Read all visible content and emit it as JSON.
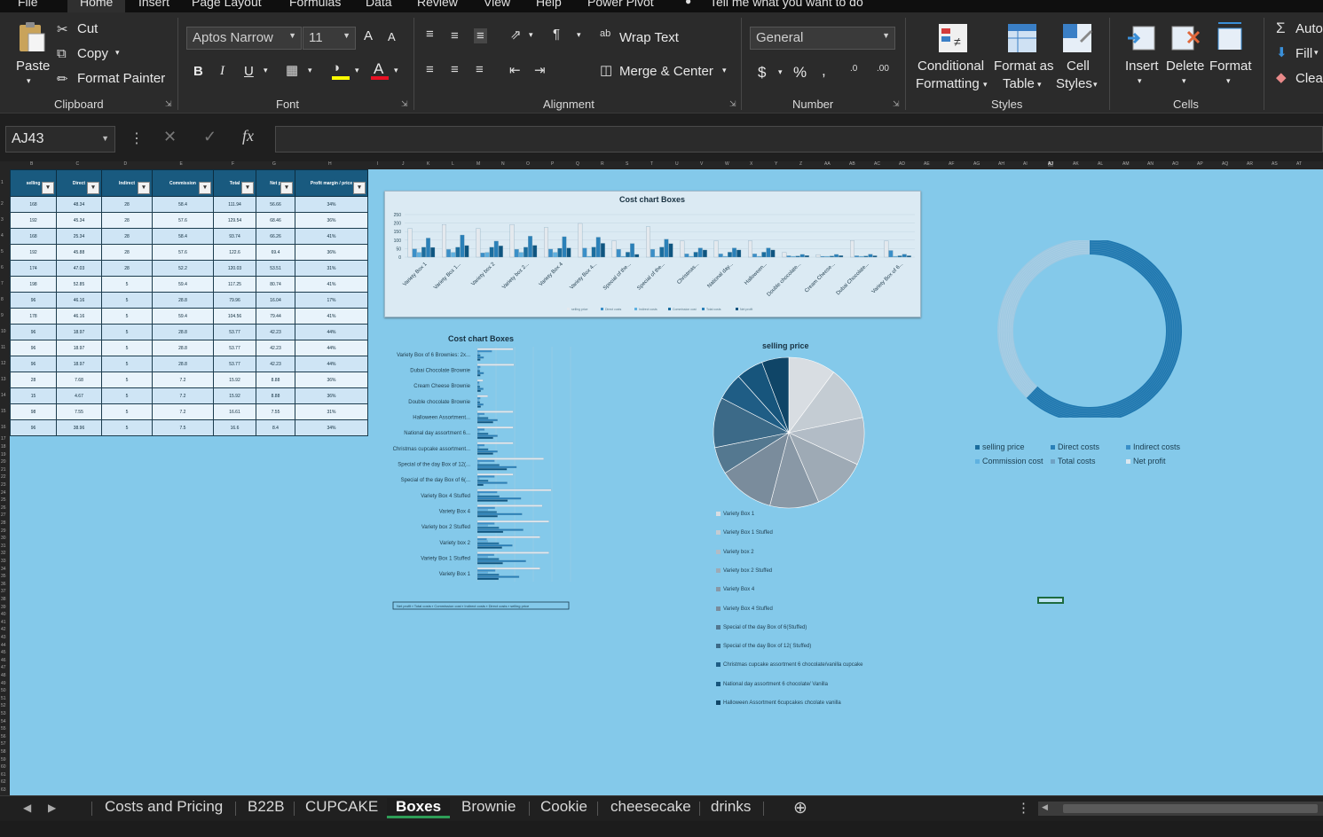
{
  "menu": {
    "tabs": [
      "File",
      "Home",
      "Insert",
      "Page Layout",
      "Formulas",
      "Data",
      "Review",
      "View",
      "Help",
      "Power Pivot"
    ],
    "active": "Home",
    "tell_me": "Tell me what you want to do"
  },
  "ribbon": {
    "clipboard": {
      "paste": "Paste",
      "cut": "Cut",
      "copy": "Copy",
      "format_painter": "Format Painter",
      "label": "Clipboard"
    },
    "font": {
      "family": "Aptos Narrow",
      "size": "11",
      "bold": "B",
      "italic": "I",
      "underline": "U",
      "label": "Font",
      "grow": "A",
      "shrink": "A"
    },
    "alignment": {
      "wrap": "Wrap Text",
      "merge": "Merge & Center",
      "label": "Alignment"
    },
    "number": {
      "format": "General",
      "currency": "$",
      "percent": "%",
      "comma": ",",
      "label": "Number"
    },
    "styles": {
      "cond1": "Conditional",
      "cond2": "Formatting",
      "fmt1": "Format as",
      "fmt2": "Table",
      "cell1": "Cell",
      "cell2": "Styles",
      "label": "Styles"
    },
    "cells": {
      "insert": "Insert",
      "delete": "Delete",
      "format": "Format",
      "label": "Cells"
    },
    "editing": {
      "autosum": "Auto",
      "fill": "Fill",
      "clear": "Clea"
    }
  },
  "formula_bar": {
    "name_box": "AJ43",
    "fx": "fx",
    "content": ""
  },
  "colors": {
    "sheet_bg": "#84c9ea",
    "header_blue": "#195a7f",
    "accent_green": "#2e9e57"
  },
  "table": {
    "headers": [
      "selling",
      "Direct",
      "Indirect",
      "Commission",
      "Total",
      "Net p",
      "Profit margin / price"
    ],
    "rows": [
      [
        "168",
        "48.34",
        "28",
        "58.4",
        "111.94",
        "56.66",
        "34%"
      ],
      [
        "192",
        "45.34",
        "28",
        "57.6",
        "129.54",
        "68.46",
        "36%"
      ],
      [
        "168",
        "25.34",
        "28",
        "58.4",
        "93.74",
        "66.26",
        "41%"
      ],
      [
        "192",
        "45.88",
        "28",
        "57.6",
        "122.6",
        "69.4",
        "36%"
      ],
      [
        "174",
        "47.03",
        "28",
        "52.2",
        "120.03",
        "53.51",
        "31%"
      ],
      [
        "198",
        "52.85",
        "5",
        "59.4",
        "117.25",
        "80.74",
        "41%"
      ],
      [
        "96",
        "46.16",
        "5",
        "28.8",
        "79.96",
        "16.04",
        "17%"
      ],
      [
        "178",
        "46.16",
        "5",
        "59.4",
        "104.56",
        "79.44",
        "41%"
      ],
      [
        "96",
        "18.97",
        "5",
        "28.8",
        "53.77",
        "42.23",
        "44%"
      ],
      [
        "96",
        "18.97",
        "5",
        "28.8",
        "53.77",
        "42.23",
        "44%"
      ],
      [
        "96",
        "18.97",
        "5",
        "28.8",
        "53.77",
        "42.23",
        "44%"
      ],
      [
        "28",
        "7.68",
        "5",
        "7.2",
        "15.92",
        "8.88",
        "36%"
      ],
      [
        "15",
        "4.67",
        "5",
        "7.2",
        "15.92",
        "8.88",
        "36%"
      ],
      [
        "98",
        "7.55",
        "5",
        "7.2",
        "16.61",
        "7.55",
        "31%"
      ],
      [
        "96",
        "38.96",
        "5",
        "7.5",
        "16.6",
        "8.4",
        "34%"
      ]
    ]
  },
  "col_letters": [
    "B",
    "C",
    "D",
    "E",
    "F",
    "G",
    "H",
    "I",
    "J",
    "K",
    "L",
    "M",
    "N",
    "O",
    "P",
    "Q",
    "R",
    "S",
    "T",
    "U",
    "V",
    "W",
    "X",
    "Y",
    "Z",
    "AA",
    "AB",
    "AC",
    "AD",
    "AE",
    "AF",
    "AG",
    "AH",
    "AI",
    "AJ",
    "AK",
    "AL",
    "AM",
    "AN",
    "AO",
    "AP",
    "AQ",
    "AR",
    "AS",
    "AT"
  ],
  "chart_data": [
    {
      "type": "bar",
      "title": "Cost chart Boxes",
      "categories": [
        "Variety Box 1",
        "Variety Box 1...",
        "Variety box 2",
        "Variety box 2...",
        "Variety Box 4",
        "Variety Box 4...",
        "Special of the...",
        "Special of the...",
        "Christmas...",
        "National day...",
        "Halloween...",
        "Double chocolate...",
        "Cream Cheese...",
        "Dubai Chocolate...",
        "Variety Box of 6..."
      ],
      "series": [
        {
          "name": "selling price",
          "color": "#e4e9ee",
          "values": [
            168,
            192,
            168,
            192,
            174,
            198,
            96,
            178,
            96,
            96,
            96,
            28,
            15,
            98,
            96
          ]
        },
        {
          "name": "Direct costs",
          "color": "#3a8fc8",
          "values": [
            48,
            45,
            25,
            46,
            47,
            53,
            46,
            46,
            19,
            19,
            19,
            8,
            5,
            8,
            39
          ]
        },
        {
          "name": "Indirect costs",
          "color": "#5fb1e0",
          "values": [
            28,
            28,
            28,
            28,
            28,
            5,
            5,
            5,
            5,
            5,
            5,
            5,
            5,
            5,
            5
          ]
        },
        {
          "name": "Commission cost",
          "color": "#1b6d9e",
          "values": [
            58,
            58,
            58,
            58,
            52,
            59,
            29,
            59,
            29,
            29,
            29,
            7,
            7,
            7,
            8
          ]
        },
        {
          "name": "Total costs",
          "color": "#2a80b8",
          "values": [
            112,
            130,
            94,
            123,
            120,
            117,
            80,
            105,
            54,
            54,
            54,
            16,
            16,
            17,
            17
          ]
        },
        {
          "name": "Net profit",
          "color": "#0e5580",
          "values": [
            57,
            68,
            66,
            69,
            54,
            81,
            16,
            79,
            42,
            42,
            42,
            9,
            9,
            8,
            8
          ]
        }
      ],
      "ylim": [
        0,
        250
      ],
      "yticks": [
        "250",
        "200",
        "150",
        "100",
        "50",
        "0"
      ]
    },
    {
      "type": "bar",
      "title": "Cost chart Boxes",
      "orientation": "horizontal",
      "categories": [
        "Variety Box of 6 Brownies: 2x...",
        "Dubai Chocolate Brownie",
        "Cream Cheese Brownie",
        "Double chocolate Brownie",
        "Halloween Assortment...",
        "National day assortment 6...",
        "Christmas cupcake assortment...",
        "Special of the day Box of 12(...",
        "Special of the day Box of 6(...",
        "Variety Box 4 Stuffed",
        "Variety Box 4",
        "Variety box 2 Stuffed",
        "Variety box 2",
        "Variety Box 1 Stuffed",
        "Variety Box 1"
      ],
      "legend": [
        "Net profit",
        "Total costs",
        "Commission cost",
        "Indirect costs",
        "Direct costs",
        "selling price"
      ]
    },
    {
      "type": "pie",
      "title": "selling price",
      "values": [
        168,
        192,
        168,
        192,
        174,
        198,
        96,
        178,
        96,
        96,
        96
      ],
      "colors": [
        "#d8dde2",
        "#c4ccd3",
        "#b2bcc6",
        "#9eaab5",
        "#8998a6",
        "#7a8c9c",
        "#547890",
        "#3c6a88",
        "#1f5d85",
        "#17557c",
        "#0f4567"
      ],
      "legend": [
        "Variety Box 1",
        "Variety Box 1 Stuffed",
        "Variety box 2",
        "Variety box 2 Stuffed",
        "Variety Box 4",
        "Variety Box 4 Stuffed",
        "Special of the day Box of 6(Stuffed)",
        "Special of the day Box of 12( Stuffed)",
        "Christmas cupcake assortment 6 chocolate/vanilla cupcake",
        "National day assortment 6 chocolate/ Vanilla",
        "Halloween Assortment 6cupcakes chcolate vanilla"
      ]
    },
    {
      "type": "pie",
      "subtype": "doughnut",
      "values": [
        62,
        38
      ],
      "colors": [
        "#1f78b0",
        "#9fc9e2"
      ],
      "legend": [
        "selling price",
        "Direct costs",
        "Indirect costs",
        "Commission cost",
        "Total costs",
        "Net profit"
      ],
      "legend_colors": [
        "#1b6d9e",
        "#2a80b8",
        "#3a8fc8",
        "#5fb1e0",
        "#6fa2c4",
        "#dbe7ef"
      ]
    }
  ],
  "sheet_tabs": [
    "Costs and Pricing",
    "B22B",
    "CUPCAKE",
    "Boxes",
    "Brownie",
    "Cookie",
    "cheesecake",
    "drinks"
  ],
  "active_tab": "Boxes"
}
